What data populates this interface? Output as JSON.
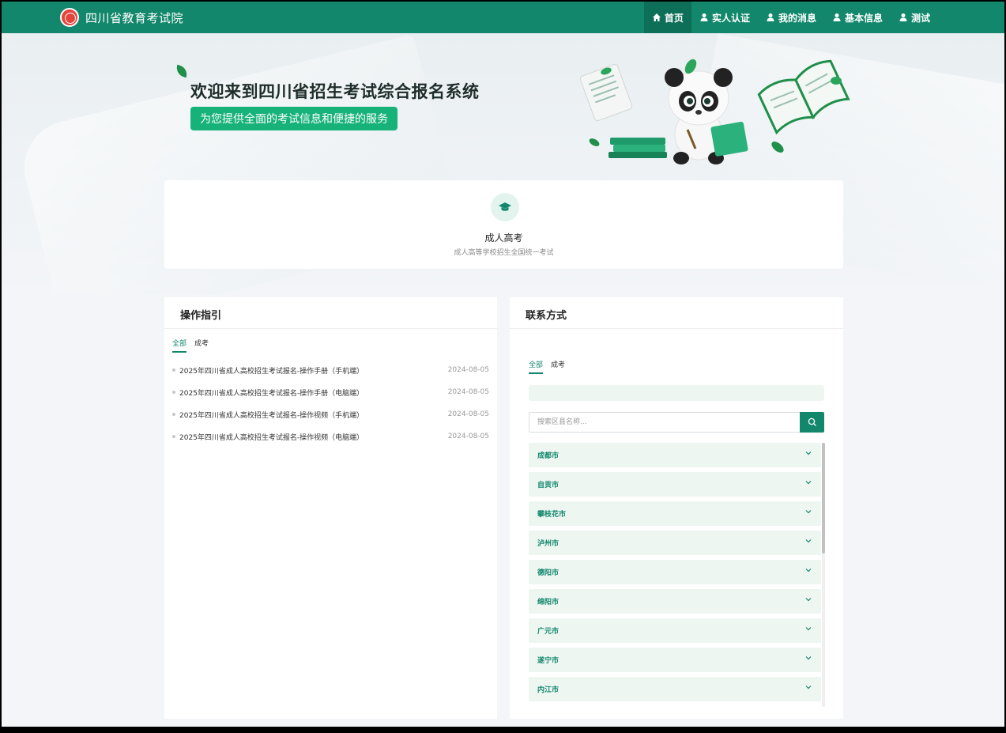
{
  "header": {
    "brand": "四川省教育考试院",
    "nav": [
      {
        "label": "首页",
        "icon": "home-icon",
        "active": true
      },
      {
        "label": "实人认证",
        "icon": "user-icon"
      },
      {
        "label": "我的消息",
        "icon": "user-icon"
      },
      {
        "label": "基本信息",
        "icon": "user-icon"
      },
      {
        "label": "测试",
        "icon": "user-icon"
      }
    ]
  },
  "hero": {
    "title": "欢迎来到四川省招生考试综合报名系统",
    "subtitle": "为您提供全面的考试信息和便捷的服务"
  },
  "exam": {
    "title": "成人高考",
    "desc": "成人高等学校招生全国统一考试"
  },
  "guide": {
    "title": "操作指引",
    "tabs": [
      "全部",
      "成考"
    ],
    "items": [
      {
        "text": "2025年四川省成人高校招生考试报名-操作手册（手机端）",
        "date": "2024-08-05"
      },
      {
        "text": "2025年四川省成人高校招生考试报名-操作手册（电脑端）",
        "date": "2024-08-05"
      },
      {
        "text": "2025年四川省成人高校招生考试报名-操作视频（手机端）",
        "date": "2024-08-05"
      },
      {
        "text": "2025年四川省成人高校招生考试报名-操作视频（电脑端）",
        "date": "2024-08-05"
      }
    ]
  },
  "contact": {
    "title": "联系方式",
    "tabs": [
      "全部",
      "成考"
    ],
    "search_placeholder": "搜索区县名称...",
    "cities": [
      "成都市",
      "自贡市",
      "攀枝花市",
      "泸州市",
      "德阳市",
      "绵阳市",
      "广元市",
      "遂宁市",
      "内江市"
    ]
  },
  "colors": {
    "primary": "#12876b",
    "accent": "#17b27a",
    "nav_active": "#0d6f57"
  }
}
